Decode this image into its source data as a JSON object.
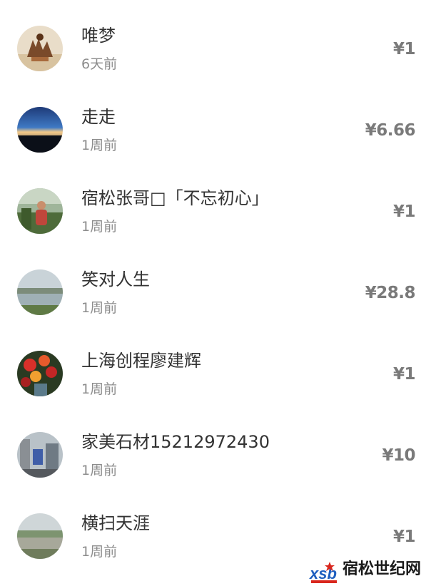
{
  "donors": [
    {
      "name": "唯梦",
      "time": "6天前",
      "amount": "¥1",
      "avatar_icon": "avatar-silhouette-photo"
    },
    {
      "name": "走走",
      "time": "1周前",
      "amount": "¥6.66",
      "avatar_icon": "avatar-horizon-photo"
    },
    {
      "name": "宿松张哥□「不忘初心」",
      "time": "1周前",
      "amount": "¥1",
      "avatar_icon": "avatar-person-photo"
    },
    {
      "name": "笑对人生",
      "time": "1周前",
      "amount": "¥28.8",
      "avatar_icon": "avatar-lake-photo"
    },
    {
      "name": "上海创程廖建辉",
      "time": "1周前",
      "amount": "¥1",
      "avatar_icon": "avatar-flowers-photo"
    },
    {
      "name": "家美石材15212972430",
      "time": "1周前",
      "amount": "¥10",
      "avatar_icon": "avatar-street-photo"
    },
    {
      "name": "横扫天涯",
      "time": "1周前",
      "amount": "¥1",
      "avatar_icon": "avatar-river-photo"
    }
  ],
  "watermark": {
    "text": "宿松世纪网",
    "logo_text": "xsb",
    "colors": {
      "logo_blue": "#1f5fbf",
      "logo_red": "#d9261c"
    }
  },
  "colors": {
    "name_text": "#333333",
    "time_text": "#8c8c8c",
    "amount_text": "#7a7a7a",
    "background": "#ffffff"
  }
}
